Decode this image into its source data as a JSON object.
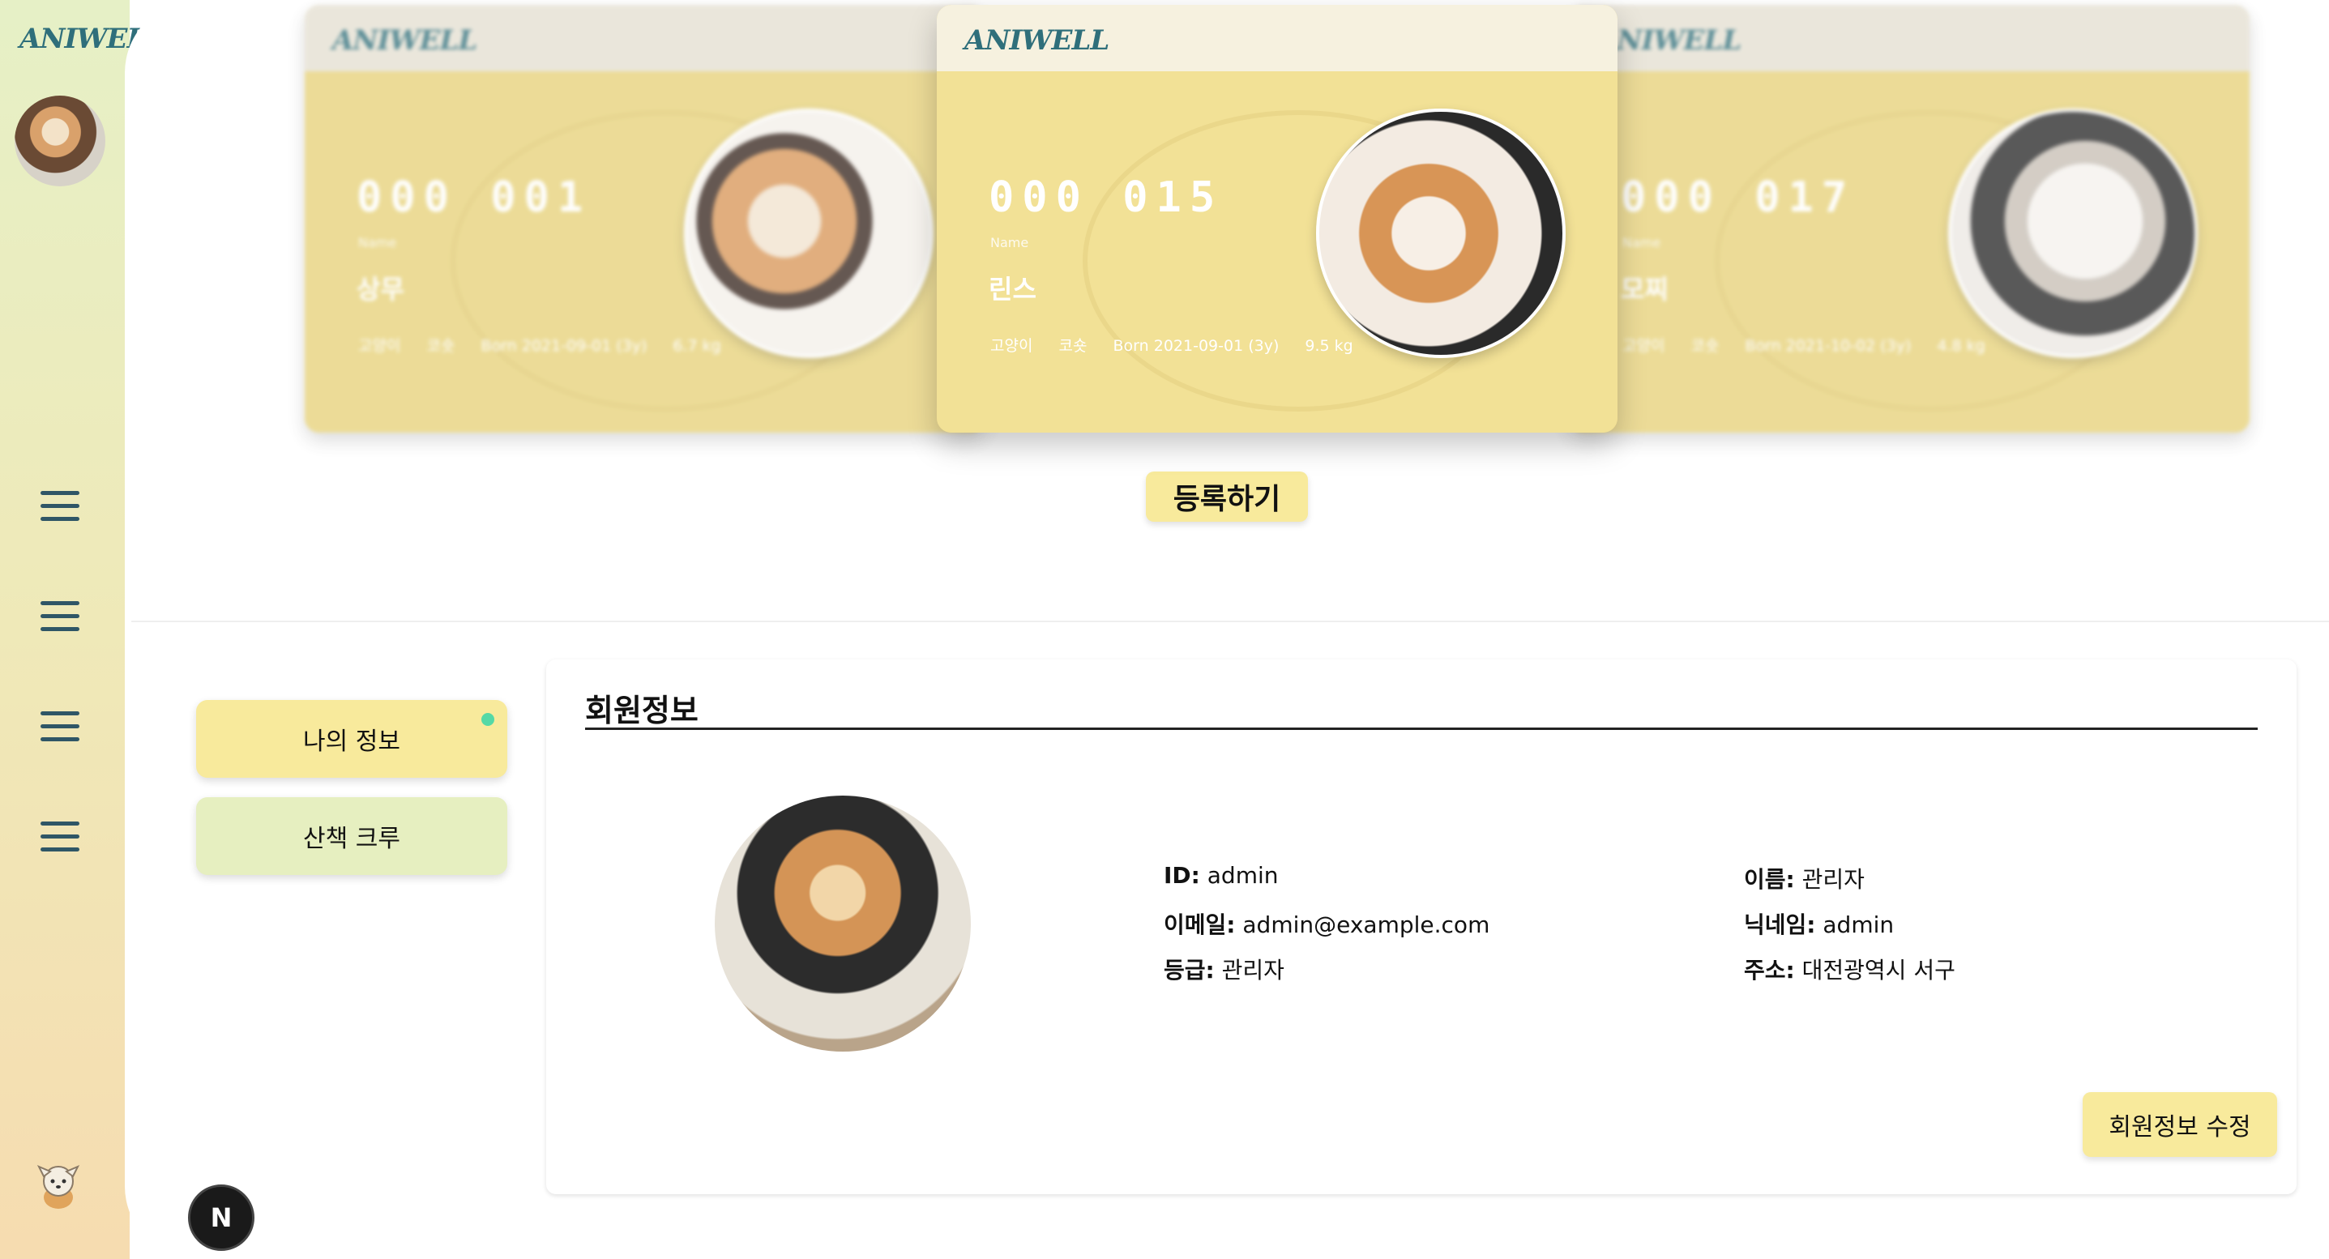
{
  "app": {
    "logo_text": "ANIWELL"
  },
  "sidebar": {
    "menu_icons": [
      "menu-icon",
      "menu-icon",
      "menu-icon",
      "menu-icon"
    ],
    "mascot_icon": "dog-mascot-icon"
  },
  "carousel": {
    "cards": [
      {
        "number": "000 001",
        "name_label": "Name",
        "name": "상무",
        "species": "고양이",
        "breed": "코숏",
        "born": "Born 2021-09-01 (3y)",
        "weight": "6.7 kg"
      },
      {
        "number": "000 015",
        "name_label": "Name",
        "name": "린스",
        "species": "고양이",
        "breed": "코숏",
        "born": "Born 2021-09-01 (3y)",
        "weight": "9.5 kg"
      },
      {
        "number": "000 017",
        "name_label": "Name",
        "name": "모찌",
        "species": "고양이",
        "breed": "코숏",
        "born": "Born 2021-10-02 (3y)",
        "weight": "4.8 kg"
      }
    ]
  },
  "register_button": "등록하기",
  "tabs": {
    "my_info": "나의 정보",
    "walk_crew": "산책 크루"
  },
  "member": {
    "title": "회원정보",
    "id_label": "ID:",
    "id": "admin",
    "email_label": "이메일:",
    "email": "admin@example.com",
    "grade_label": "등급:",
    "grade": "관리자",
    "name_label": "이름:",
    "name": "관리자",
    "nickname_label": "닉네임:",
    "nickname": "admin",
    "address_label": "주소:",
    "address": "대전광역시 서구",
    "edit_button": "회원정보 수정"
  },
  "dev_badge": "N",
  "colors": {
    "accent_yellow": "#f8ea9c",
    "accent_green": "#e6efc0",
    "card_body": "#f2e196",
    "icon_blue": "#2f5666",
    "active_dot": "#55d9a6"
  }
}
